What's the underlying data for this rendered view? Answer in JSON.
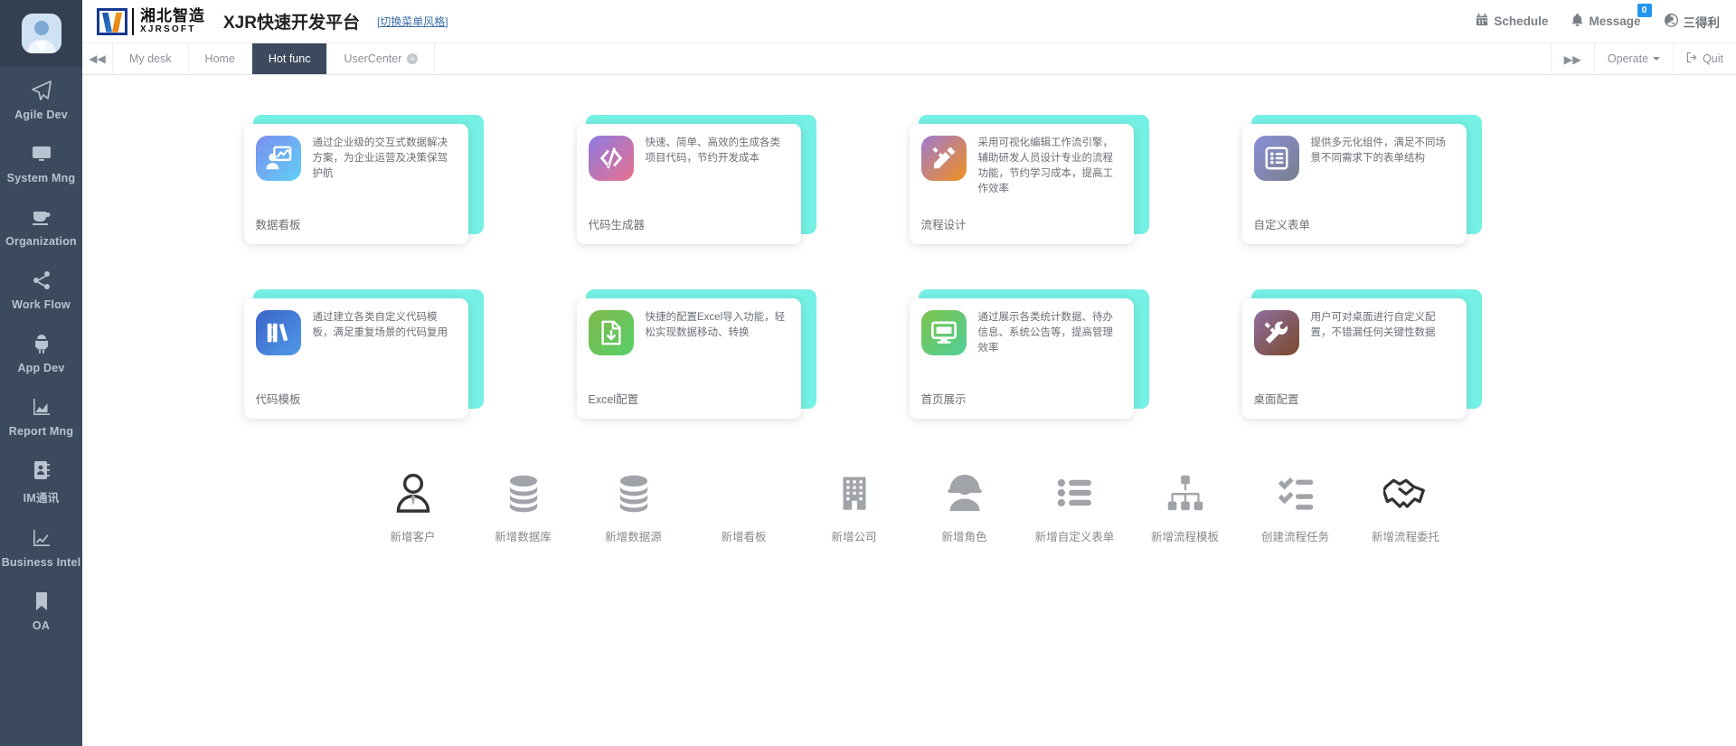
{
  "header": {
    "logo_cn": "湘北智造",
    "logo_en": "XJRSOFT",
    "app_title": "XJR快速开发平台",
    "switch_style": "[切换菜单风格]",
    "schedule_label": "Schedule",
    "message_label": "Message",
    "message_badge": "0",
    "user_name": "三得利"
  },
  "tabs": {
    "prev_label": "◀◀",
    "next_label": "▶▶",
    "items": [
      {
        "label": "My desk",
        "active": false,
        "closable": false
      },
      {
        "label": "Home",
        "active": false,
        "closable": false
      },
      {
        "label": "Hot func",
        "active": true,
        "closable": false
      },
      {
        "label": "UserCenter",
        "active": false,
        "closable": true
      }
    ],
    "operate_label": "Operate",
    "quit_label": "Quit"
  },
  "sidebar": {
    "avatar": "user-avatar",
    "items": [
      {
        "label": "Agile Dev",
        "icon": "paper-plane-icon"
      },
      {
        "label": "System Mng",
        "icon": "monitor-icon"
      },
      {
        "label": "Organization",
        "icon": "coffee-cup-icon"
      },
      {
        "label": "Work Flow",
        "icon": "share-nodes-icon"
      },
      {
        "label": "App Dev",
        "icon": "android-robot-icon"
      },
      {
        "label": "Report Mng",
        "icon": "area-chart-icon"
      },
      {
        "label": "IM通讯",
        "icon": "contact-book-icon"
      },
      {
        "label": "Business Intel",
        "icon": "line-chart-icon"
      },
      {
        "label": "OA",
        "icon": "bookmark-icon"
      }
    ]
  },
  "cards": [
    {
      "title": "数据看板",
      "desc": "通过企业级的交互式数据解决方案，为企业运营及决策保驾护航",
      "icon": "dashboard-presentation-icon",
      "gradient_from": "#7b8df0",
      "gradient_to": "#5fd0f5"
    },
    {
      "title": "代码生成器",
      "desc": "快速、简单、高效的生成各类项目代码，节约开发成本",
      "icon": "code-brackets-icon",
      "gradient_from": "#8e7ae0",
      "gradient_to": "#e8718e"
    },
    {
      "title": "流程设计",
      "desc": "采用可视化编辑工作流引擎，辅助研发人员设计专业的流程功能，节约学习成本，提高工作效率",
      "icon": "pen-ruler-icon",
      "gradient_from": "#a07ad0",
      "gradient_to": "#f0901f"
    },
    {
      "title": "自定义表单",
      "desc": "提供多元化组件，满足不同场景不同需求下的表单结构",
      "icon": "form-list-icon",
      "gradient_from": "#8b8fd8",
      "gradient_to": "#7a7f8c"
    },
    {
      "title": "代码模板",
      "desc": "通过建立各类自定义代码模板，满足重复场景的代码复用",
      "icon": "book-library-icon",
      "gradient_from": "#3b63c8",
      "gradient_to": "#4f9ae8"
    },
    {
      "title": "Excel配置",
      "desc": "快捷的配置Excel导入功能，轻松实现数据移动、转换",
      "icon": "excel-import-icon",
      "gradient_from": "#7fb84a",
      "gradient_to": "#58d06a"
    },
    {
      "title": "首页展示",
      "desc": "通过展示各类统计数据、待办信息、系统公告等，提高管理效率",
      "icon": "monitor-display-icon",
      "gradient_from": "#7ec34a",
      "gradient_to": "#4fd09a"
    },
    {
      "title": "桌面配置",
      "desc": "用户可对桌面进行自定义配置，不错漏任何关键性数据",
      "icon": "wrench-screwdriver-icon",
      "gradient_from": "#8f6ea0",
      "gradient_to": "#7a4a2a"
    }
  ],
  "quick_actions": [
    {
      "label": "新增客户",
      "icon": "person-tie-icon"
    },
    {
      "label": "新增数据库",
      "icon": "database-icon"
    },
    {
      "label": "新增数据源",
      "icon": "database-icon"
    },
    {
      "label": "新增看板",
      "icon": "dashboard-presentation-icon"
    },
    {
      "label": "新增公司",
      "icon": "building-icon"
    },
    {
      "label": "新增角色",
      "icon": "hardhat-person-icon"
    },
    {
      "label": "新增自定义表单",
      "icon": "list-bullet-icon"
    },
    {
      "label": "新增流程模板",
      "icon": "sitemap-icon"
    },
    {
      "label": "创建流程任务",
      "icon": "checklist-icon"
    },
    {
      "label": "新增流程委托",
      "icon": "handshake-icon"
    }
  ],
  "colors": {
    "sidebar_bg": "#3b4a5c",
    "card_back": "#75f0e4",
    "accent_blue": "#2196f3"
  }
}
